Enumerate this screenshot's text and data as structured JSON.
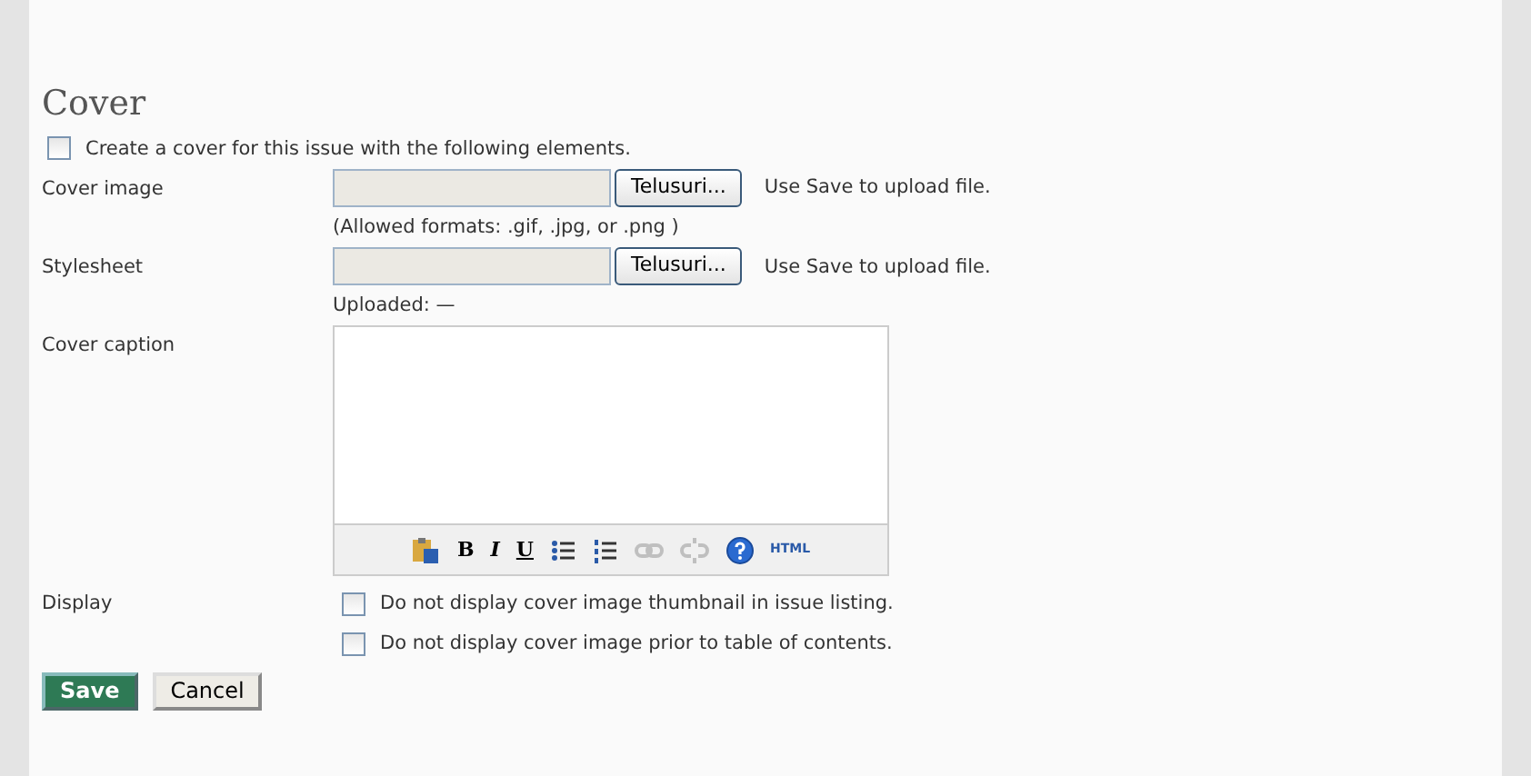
{
  "heading": "Cover",
  "create_cover": {
    "label": "Create a cover for this issue with the following elements.",
    "checked": false
  },
  "file_fields": [
    {
      "label": "Cover image",
      "button": "Telusuri...",
      "hint": "Use Save to upload file.",
      "note": "(Allowed formats: .gif, .jpg, or .png )"
    },
    {
      "label": "Stylesheet",
      "button": "Telusuri...",
      "hint": "Use Save to upload file.",
      "note": "Uploaded: —"
    }
  ],
  "caption": {
    "label": "Cover caption",
    "toolbar": [
      {
        "kind": "paste",
        "disabled": false
      },
      {
        "kind": "bold",
        "text": "B",
        "disabled": false
      },
      {
        "kind": "italic",
        "text": "I",
        "disabled": false
      },
      {
        "kind": "underline",
        "text": "U",
        "disabled": false
      },
      {
        "kind": "bullets",
        "disabled": false
      },
      {
        "kind": "numbers",
        "disabled": false
      },
      {
        "kind": "link",
        "disabled": true
      },
      {
        "kind": "unlink",
        "disabled": true
      },
      {
        "kind": "help",
        "disabled": false
      },
      {
        "kind": "html",
        "text": "HTML",
        "disabled": false
      }
    ]
  },
  "display": {
    "label": "Display",
    "options": [
      {
        "label": "Do not display cover image thumbnail in issue listing.",
        "checked": false
      },
      {
        "label": "Do not display cover image prior to table of contents.",
        "checked": false
      }
    ]
  },
  "buttons": [
    {
      "label": "Save",
      "kind": "primary"
    },
    {
      "label": "Cancel",
      "kind": "secondary"
    }
  ]
}
